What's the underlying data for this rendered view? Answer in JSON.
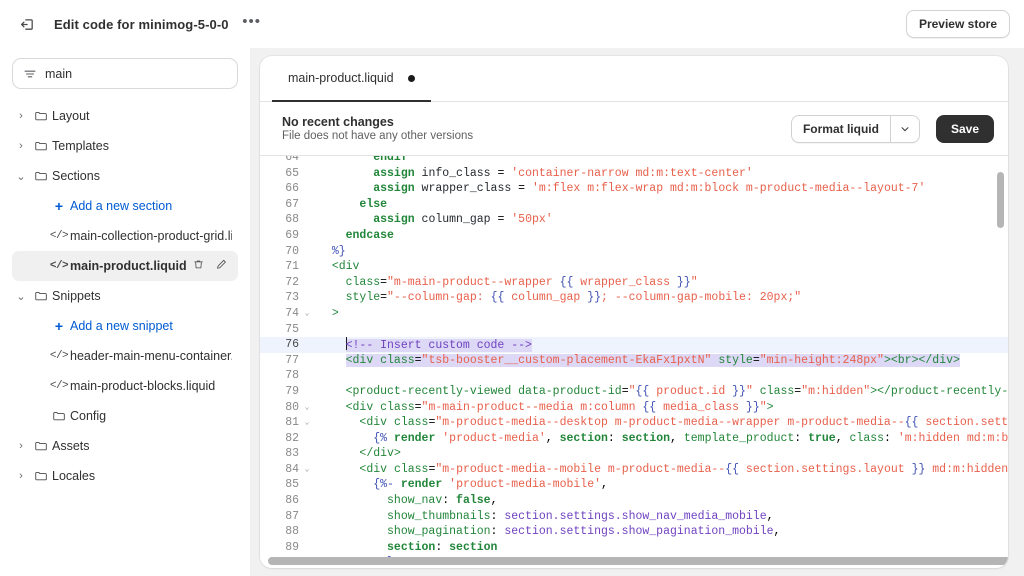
{
  "topbar": {
    "exit_icon": "exit-icon",
    "title": "Edit code for minimog-5-0-0",
    "kebab": "•••",
    "preview_label": "Preview store"
  },
  "sidebar": {
    "search": {
      "value": "main",
      "icon": "filter-lines-icon"
    },
    "items": [
      {
        "type": "folder",
        "label": "Layout",
        "chevron": "›",
        "indent": 0,
        "selected": false
      },
      {
        "type": "folder",
        "label": "Templates",
        "chevron": "›",
        "indent": 0,
        "selected": false
      },
      {
        "type": "folder",
        "label": "Sections",
        "chevron": "⌄",
        "indent": 0,
        "selected": false
      },
      {
        "type": "add",
        "label": "Add a new section",
        "chevron": "",
        "indent": 1,
        "selected": false
      },
      {
        "type": "file",
        "label": "main-collection-product-grid.liquid",
        "chevron": "",
        "indent": 1,
        "selected": false
      },
      {
        "type": "file",
        "label": "main-product.liquid",
        "chevron": "",
        "indent": 1,
        "selected": true
      },
      {
        "type": "folder",
        "label": "Snippets",
        "chevron": "⌄",
        "indent": 0,
        "selected": false
      },
      {
        "type": "add",
        "label": "Add a new snippet",
        "chevron": "",
        "indent": 1,
        "selected": false
      },
      {
        "type": "file",
        "label": "header-main-menu-container.liquid",
        "chevron": "",
        "indent": 1,
        "selected": false
      },
      {
        "type": "file",
        "label": "main-product-blocks.liquid",
        "chevron": "",
        "indent": 1,
        "selected": false
      },
      {
        "type": "folder",
        "label": "Config",
        "chevron": "",
        "indent": 1,
        "selected": false
      },
      {
        "type": "folder",
        "label": "Assets",
        "chevron": "›",
        "indent": 0,
        "selected": false
      },
      {
        "type": "folder",
        "label": "Locales",
        "chevron": "›",
        "indent": 0,
        "selected": false
      }
    ],
    "row_actions": {
      "delete": "trash-icon",
      "rename": "pencil-icon"
    }
  },
  "editor": {
    "tab": {
      "label": "main-product.liquid",
      "modified_dot": true
    },
    "versions": {
      "title": "No recent changes",
      "subtitle": "File does not have any other versions"
    },
    "format_button": {
      "label": "Format liquid",
      "caret": "⌄"
    },
    "save_button": {
      "label": "Save"
    },
    "first_line_number": 64,
    "active_line": 76,
    "selected_lines": [
      76,
      77
    ],
    "lines": [
      {
        "n": 64,
        "fold": false,
        "text": "        endif"
      },
      {
        "n": 65,
        "fold": false,
        "text": "        assign info_class = 'container-narrow md:m:text-center'"
      },
      {
        "n": 66,
        "fold": false,
        "text": "        assign wrapper_class = 'm:flex m:flex-wrap md:m:block m-product-media--layout-7'"
      },
      {
        "n": 67,
        "fold": false,
        "text": "      else"
      },
      {
        "n": 68,
        "fold": false,
        "text": "        assign column_gap = '50px'"
      },
      {
        "n": 69,
        "fold": false,
        "text": "    endcase"
      },
      {
        "n": 70,
        "fold": false,
        "text": "  %}"
      },
      {
        "n": 71,
        "fold": false,
        "text": "  <div"
      },
      {
        "n": 72,
        "fold": false,
        "text": "    class=\"m-main-product--wrapper {{ wrapper_class }}\""
      },
      {
        "n": 73,
        "fold": false,
        "text": "    style=\"--column-gap: {{ column_gap }}; --column-gap-mobile: 20px;\""
      },
      {
        "n": 74,
        "fold": true,
        "text": "  >"
      },
      {
        "n": 75,
        "fold": false,
        "text": ""
      },
      {
        "n": 76,
        "fold": false,
        "text": "    <!-- Insert custom code -->"
      },
      {
        "n": 77,
        "fold": false,
        "text": "    <div class=\"tsb-booster__custom-placement-EkaFx1pxtN\" style=\"min-height:248px\"><br></div>"
      },
      {
        "n": 78,
        "fold": false,
        "text": ""
      },
      {
        "n": 79,
        "fold": false,
        "text": "    <product-recently-viewed data-product-id=\"{{ product.id }}\" class=\"m:hidden\"></product-recently-viewed>"
      },
      {
        "n": 80,
        "fold": true,
        "text": "    <div class=\"m-main-product--media m:column {{ media_class }}\">"
      },
      {
        "n": 81,
        "fold": true,
        "text": "      <div class=\"m-product-media--desktop m-product-media--wrapper m-product-media--{{ section.settings.layout }}"
      },
      {
        "n": 82,
        "fold": false,
        "text": "        {% render 'product-media', section: section, template_product: true, class: 'm:hidden md:m:block' %}"
      },
      {
        "n": 83,
        "fold": false,
        "text": "      </div>"
      },
      {
        "n": 84,
        "fold": true,
        "text": "      <div class=\"m-product-media--mobile m-product-media--{{ section.settings.layout }} md:m:hidden\">"
      },
      {
        "n": 85,
        "fold": false,
        "text": "        {%- render 'product-media-mobile',"
      },
      {
        "n": 86,
        "fold": false,
        "text": "          show_nav: false,"
      },
      {
        "n": 87,
        "fold": false,
        "text": "          show_thumbnails: section.settings.show_nav_media_mobile,"
      },
      {
        "n": 88,
        "fold": false,
        "text": "          show_pagination: section.settings.show_pagination_mobile,"
      },
      {
        "n": 89,
        "fold": false,
        "text": "          section: section"
      },
      {
        "n": 90,
        "fold": false,
        "text": "        -%}"
      }
    ]
  },
  "colors": {
    "accent_link": "#005bd3",
    "save_bg": "#303030",
    "selection": "#dcd8f5",
    "active_line": "#eff3fd",
    "string": "#e8604c",
    "tag": "#22863a",
    "variable": "#6f42c1",
    "punctuation": "#3f51b5"
  }
}
